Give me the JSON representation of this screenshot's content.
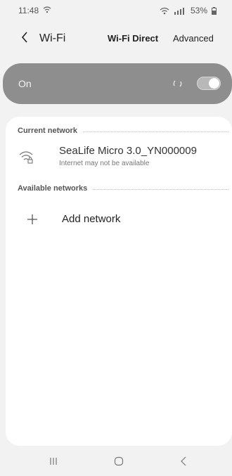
{
  "status_bar": {
    "time": "11:48",
    "battery": "53%"
  },
  "header": {
    "title": "Wi-Fi",
    "wifi_direct_label": "Wi-Fi Direct",
    "advanced_label": "Advanced"
  },
  "toggle_card": {
    "label": "On",
    "state": "on"
  },
  "current_network": {
    "section_label": "Current network",
    "name": "SeaLife Micro 3.0_YN000009",
    "status": "Internet may not be available"
  },
  "available_networks": {
    "section_label": "Available networks",
    "add_label": "Add network"
  },
  "icons": {
    "status_left": "wifi-signal-icon",
    "back": "chevron-left-icon",
    "network": "wifi-lock-icon",
    "add": "plus-icon",
    "nav_recents": "recents-icon",
    "nav_home": "home-icon",
    "nav_back": "back-icon"
  },
  "colors": {
    "background": "#f2f2f2",
    "toggle_card": "#8e8e8e",
    "card": "#ffffff"
  }
}
